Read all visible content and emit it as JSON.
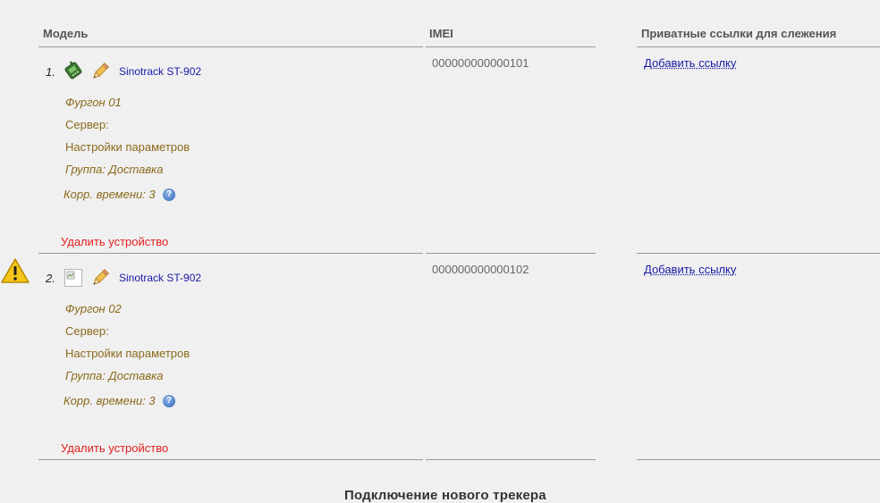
{
  "columns": {
    "model": "Модель",
    "imei": "IMEI",
    "links": "Приватные ссылки для слежения"
  },
  "devices": [
    {
      "num": "1.",
      "model": "Sinotrack ST-902",
      "imei": "000000000000101",
      "add_link": "Добавить ссылку",
      "name": "Фургон 01",
      "server": "Сервер:",
      "settings": "Настройки параметров",
      "group": "Группа: Доставка",
      "time_corr": "Корр. времени: 3",
      "delete": "Удалить устройство",
      "device_icon": "gps-tracker-icon"
    },
    {
      "num": "2.",
      "model": "Sinotrack ST-902",
      "imei": "000000000000102",
      "add_link": "Добавить ссылку",
      "name": "Фургон 02",
      "server": "Сервер:",
      "settings": "Настройки параметров",
      "group": "Группа: Доставка",
      "time_corr": "Корр. времени: 3",
      "delete": "Удалить устройство",
      "device_icon": "broken-image-icon",
      "warning_icon": "warning-icon"
    }
  ],
  "section_title": "Подключение нового трекера",
  "help_glyph": "?"
}
